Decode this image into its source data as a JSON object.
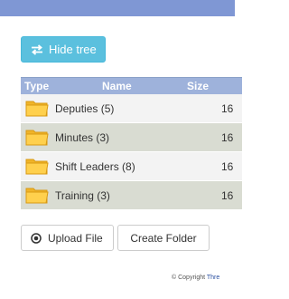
{
  "toolbar": {
    "hide_tree_label": "Hide tree",
    "accent_color": "#5bc0de"
  },
  "table": {
    "headers": {
      "type": "Type",
      "name": "Name",
      "size": "Size"
    },
    "rows": [
      {
        "icon": "folder-icon",
        "name": "Deputies (5)",
        "size": "16"
      },
      {
        "icon": "folder-icon",
        "name": "Minutes (3)",
        "size": "16"
      },
      {
        "icon": "folder-icon",
        "name": "Shift Leaders (8)",
        "size": "16"
      },
      {
        "icon": "folder-icon",
        "name": "Training (3)",
        "size": "16"
      }
    ]
  },
  "actions": {
    "upload_label": "Upload File",
    "create_folder_label": "Create Folder"
  },
  "footer": {
    "copyright": "© Copyright",
    "link": "Thre"
  }
}
